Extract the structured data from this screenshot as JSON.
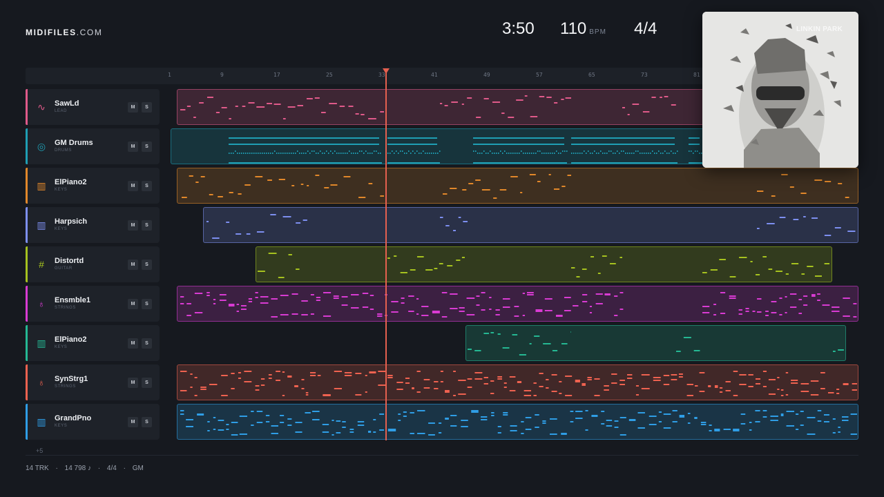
{
  "brand": {
    "name": "MIDIFILES",
    "suffix": ".COM"
  },
  "transport": {
    "time": "3:50",
    "bpm_value": "110",
    "bpm_unit": "BPM",
    "meter": "4/4"
  },
  "ruler": {
    "ticks": [
      "1",
      "9",
      "17",
      "25",
      "33",
      "41",
      "49",
      "57",
      "65",
      "73",
      "81"
    ]
  },
  "playhead": {
    "bar": 33
  },
  "tracks": [
    {
      "name": "SawLd",
      "category": "LEAD",
      "icon": "waveform-icon",
      "color": "#e05a8a",
      "mute": "M",
      "solo": "S"
    },
    {
      "name": "GM Drums",
      "category": "DRUMS",
      "icon": "drum-icon",
      "color": "#1f9fb4",
      "mute": "M",
      "solo": "S"
    },
    {
      "name": "ElPiano2",
      "category": "KEYS",
      "icon": "keyboard-icon",
      "color": "#e2882a",
      "mute": "M",
      "solo": "S"
    },
    {
      "name": "Harpsich",
      "category": "KEYS",
      "icon": "keyboard-icon",
      "color": "#7d8ff0",
      "mute": "M",
      "solo": "S"
    },
    {
      "name": "Distortd",
      "category": "GUITAR",
      "icon": "guitar-grid-icon",
      "color": "#a6c21f",
      "mute": "M",
      "solo": "S"
    },
    {
      "name": "Ensmble1",
      "category": "STRINGS",
      "icon": "violin-icon",
      "color": "#d93bd3",
      "mute": "M",
      "solo": "S"
    },
    {
      "name": "ElPiano2",
      "category": "KEYS",
      "icon": "keyboard-icon",
      "color": "#25b893",
      "mute": "M",
      "solo": "S"
    },
    {
      "name": "SynStrg1",
      "category": "STRINGS",
      "icon": "violin-icon",
      "color": "#ef6250",
      "mute": "M",
      "solo": "S"
    },
    {
      "name": "GrandPno",
      "category": "KEYS",
      "icon": "keyboard-icon",
      "color": "#2f9ee6",
      "mute": "M",
      "solo": "S"
    }
  ],
  "more_tracks": "+5",
  "footer": {
    "tracks": "14 TRK",
    "notes": "14 798 ♪",
    "meter": "4/4",
    "standard": "GM",
    "sep": "·"
  },
  "album": {
    "artist_text": "LINKIN PARK"
  }
}
